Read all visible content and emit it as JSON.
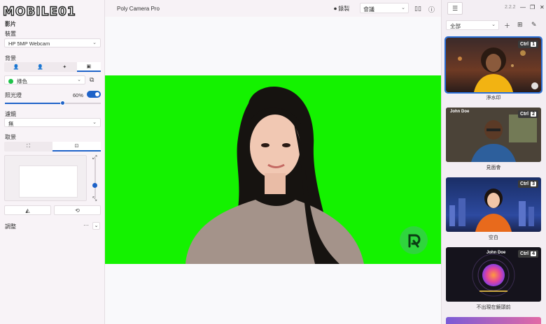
{
  "watermark": "MOBILE01",
  "app": {
    "name": "Poly Camera Pro",
    "version": "2.2.2"
  },
  "topbar": {
    "record_label": "錄製",
    "meeting_select": "會議"
  },
  "left": {
    "video_title": "影片",
    "device_label": "裝置",
    "device_value": "HP 5MP Webcam",
    "background_label": "背景",
    "bg_color_value": "綠色",
    "lighting_label": "照光燈",
    "lighting_value": "60%",
    "lighting_level": 0.6,
    "filter_label": "濾鏡",
    "filter_value": "無",
    "framing_label": "取景",
    "adjust_label": "調整"
  },
  "right": {
    "filter_value": "全部",
    "cards": [
      {
        "ctrl": "Ctrl",
        "num": "1",
        "label": "淨水印"
      },
      {
        "ctrl": "Ctrl",
        "num": "2",
        "label": "見面會",
        "name": "John Doe"
      },
      {
        "ctrl": "Ctrl",
        "num": "3",
        "label": "空白"
      },
      {
        "ctrl": "Ctrl",
        "num": "4",
        "label": "不出現在鏡頭前",
        "name": "John Doe"
      }
    ]
  },
  "colors": {
    "accent": "#1e62c8",
    "green_screen": "#14f200",
    "selected_outline": "#2b6fd6"
  }
}
